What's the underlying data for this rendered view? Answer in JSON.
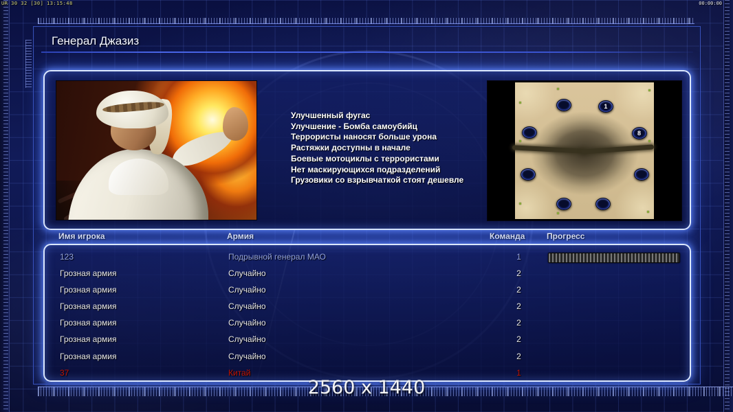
{
  "hud": {
    "debug_text": "UR 30 32 [30] 13:15:48",
    "clock": "00:00:00"
  },
  "header": {
    "title": "Генерал Джазиз"
  },
  "general_panel": {
    "bonuses": [
      "Улучшенный фугас",
      "Улучшение - Бомба самоубийц",
      "Террористы наносят больше урона",
      "Растяжки доступны в начале",
      "Боевые мотоциклы с террористами",
      "Нет маскирующихся подразделений",
      "Грузовики со взрывчаткой стоят дешевле"
    ],
    "map": {
      "markers": [
        {
          "x": 34.5,
          "y": 16.0,
          "label": ""
        },
        {
          "x": 64.8,
          "y": 17.0,
          "label": "1"
        },
        {
          "x": 10.0,
          "y": 36.0,
          "label": ""
        },
        {
          "x": 88.9,
          "y": 36.5,
          "label": "8"
        },
        {
          "x": 9.0,
          "y": 67.0,
          "label": ""
        },
        {
          "x": 90.4,
          "y": 67.0,
          "label": ""
        },
        {
          "x": 34.5,
          "y": 88.6,
          "label": ""
        },
        {
          "x": 62.8,
          "y": 88.6,
          "label": ""
        }
      ]
    }
  },
  "players": {
    "headers": {
      "name": "Имя игрока",
      "army": "Армия",
      "team": "Команда",
      "progress": "Прогресс"
    },
    "rows": [
      {
        "name": "123",
        "army": "Подрывной генерал МАО",
        "team": "1",
        "color": "#93a2dc",
        "progress_percent": 100
      },
      {
        "name": "Грозная армия",
        "army": "Случайно",
        "team": "2",
        "color": "#e8e8e8",
        "progress_percent": null
      },
      {
        "name": "Грозная армия",
        "army": "Случайно",
        "team": "2",
        "color": "#e8e8e8",
        "progress_percent": null
      },
      {
        "name": "Грозная армия",
        "army": "Случайно",
        "team": "2",
        "color": "#e8e8e8",
        "progress_percent": null
      },
      {
        "name": "Грозная армия",
        "army": "Случайно",
        "team": "2",
        "color": "#e8e8e8",
        "progress_percent": null
      },
      {
        "name": "Грозная армия",
        "army": "Случайно",
        "team": "2",
        "color": "#e8e8e8",
        "progress_percent": null
      },
      {
        "name": "Грозная армия",
        "army": "Случайно",
        "team": "2",
        "color": "#e8e8e8",
        "progress_percent": null
      },
      {
        "name": "37",
        "army": "Китай",
        "team": "1",
        "color": "#bf1404",
        "progress_percent": null
      }
    ]
  },
  "footer": {
    "resolution_text": "2560 x 1440"
  },
  "colors": {
    "panel_border": "#dce8ff",
    "panel_glow": "#4d7dff",
    "grid_line": "#3c55c8",
    "title_rule": "#3a55cf",
    "local_player_text": "#93a2dc",
    "red_player_text": "#bf1404",
    "bonus_text": "#fdfdfd"
  }
}
